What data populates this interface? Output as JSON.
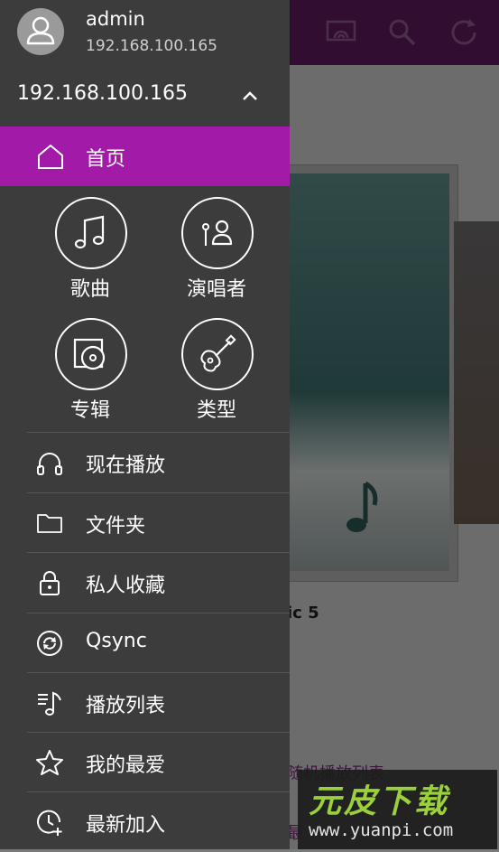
{
  "drawer": {
    "user": {
      "name": "admin",
      "address": "192.168.100.165"
    },
    "server": "192.168.100.165",
    "home": {
      "label": "首页",
      "icon": "home-icon"
    },
    "grid": [
      {
        "label": "歌曲",
        "icon": "music-note-icon"
      },
      {
        "label": "演唱者",
        "icon": "artist-icon"
      },
      {
        "label": "专辑",
        "icon": "album-icon"
      },
      {
        "label": "类型",
        "icon": "guitar-icon"
      }
    ],
    "menu": [
      {
        "label": "现在播放",
        "icon": "headphones-icon"
      },
      {
        "label": "文件夹",
        "icon": "folder-icon"
      },
      {
        "label": "私人收藏",
        "icon": "lock-icon"
      },
      {
        "label": "Qsync",
        "icon": "qsync-icon"
      },
      {
        "label": "播放列表",
        "icon": "playlist-icon"
      },
      {
        "label": "我的最爱",
        "icon": "star-icon"
      },
      {
        "label": "最新加入",
        "icon": "recent-add-icon"
      }
    ],
    "accent": "#a11aa8"
  },
  "background": {
    "card_title": "ic 5",
    "link1": "随机播放列表",
    "link2": "最"
  },
  "watermark": {
    "logo": "元皮下载",
    "url": "www.yuanpi.com"
  }
}
